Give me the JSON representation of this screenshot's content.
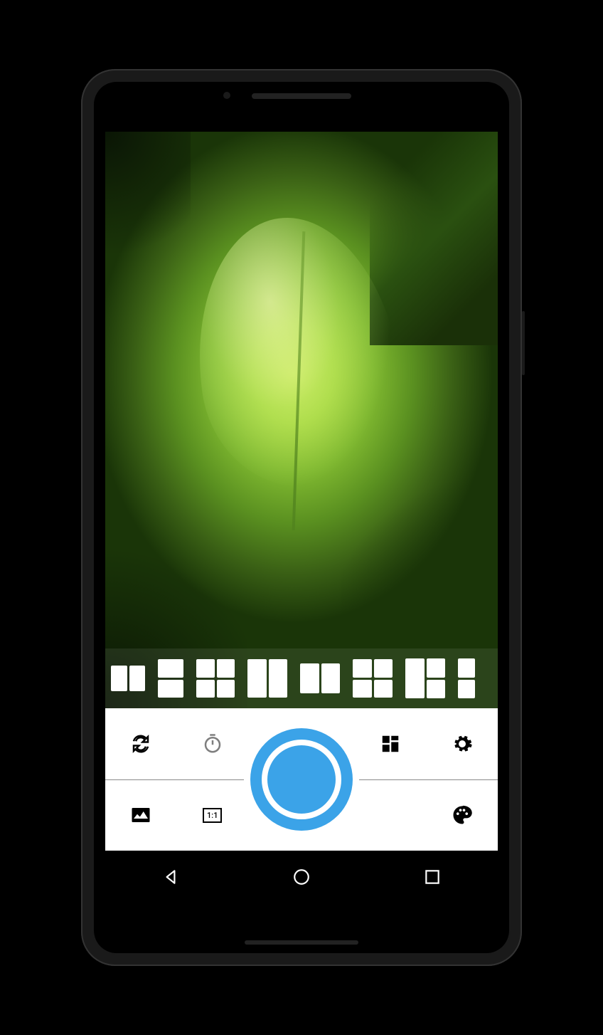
{
  "toolbar": {
    "switch_camera": "switch-camera",
    "timer": "timer",
    "collage_layout": "collage-layout",
    "settings": "settings",
    "gallery": "gallery",
    "aspect_ratio": "1:1",
    "color_palette": "color-palette"
  },
  "shutter": {
    "color": "#3ba3e8"
  },
  "collage_templates": [
    {
      "name": "2-col-horizontal"
    },
    {
      "name": "2-row-vertical"
    },
    {
      "name": "2x2-grid"
    },
    {
      "name": "2-col-tall"
    },
    {
      "name": "2-col-wide"
    },
    {
      "name": "2x2-offset"
    },
    {
      "name": "3-cell-mixed"
    },
    {
      "name": "2-row-narrow"
    }
  ],
  "navbar": {
    "back": "back",
    "home": "home",
    "recent": "recent"
  }
}
